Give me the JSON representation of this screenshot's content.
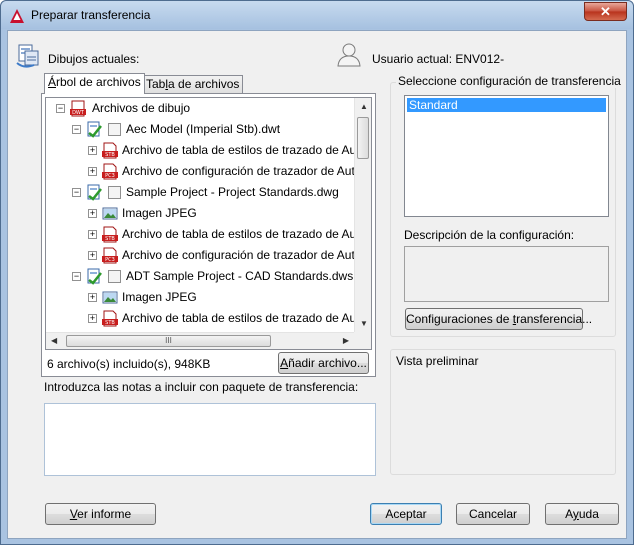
{
  "window": {
    "title": "Preparar transferencia",
    "close_glyph": "✕"
  },
  "header": {
    "current_drawings_label": "Dibujos actuales:",
    "current_user_label": "Usuario actual: ENV012-"
  },
  "tabs": [
    {
      "label_pre": "",
      "label_u": "Á",
      "label_post": "rbol de archivos",
      "active": true
    },
    {
      "label_pre": "Tab",
      "label_u": "l",
      "label_post": "a de archivos",
      "active": false
    }
  ],
  "tree": {
    "root": "Archivos de dibujo",
    "rows": [
      {
        "text": "Aec Model (Imperial Stb).dwt",
        "level": 1,
        "icon": "drawing-icon",
        "check": true
      },
      {
        "text": "Archivo de tabla de estilos de trazado de AutoCA",
        "level": 2,
        "icon": "stb-file-icon"
      },
      {
        "text": "Archivo de configuración de trazador de AutoCA",
        "level": 2,
        "icon": "pc3-file-icon"
      },
      {
        "text": "Sample Project - Project Standards.dwg",
        "level": 1,
        "icon": "drawing-icon",
        "check": true
      },
      {
        "text": "Imagen JPEG",
        "level": 2,
        "icon": "jpeg-image-icon"
      },
      {
        "text": "Archivo de tabla de estilos de trazado de AutoCA",
        "level": 2,
        "icon": "stb-file-icon"
      },
      {
        "text": "Archivo de configuración de trazador de AutoCA",
        "level": 2,
        "icon": "pc3-file-icon"
      },
      {
        "text": "ADT Sample Project - CAD Standards.dws",
        "level": 1,
        "icon": "drawing-icon",
        "check": true
      },
      {
        "text": "Imagen JPEG",
        "level": 2,
        "icon": "jpeg-image-icon"
      },
      {
        "text": "Archivo de tabla de estilos de trazado de AutoCA",
        "level": 2,
        "icon": "stb-file-icon"
      }
    ],
    "scroll_grip": "III"
  },
  "files_summary": "6 archivo(s) incluido(s), 948KB",
  "add_file_button": {
    "pre": "",
    "u": "A",
    "post": "ñadir archivo..."
  },
  "notes_label": "Introduzca las notas a incluir con paquete de transferencia:",
  "transfer_setup": {
    "label": "Seleccione configuración de transferencia",
    "items": [
      "Standard"
    ],
    "selected": "Standard",
    "description_label": "Descripción de la configuración:",
    "setups_button": {
      "pre": "Configuraciones de ",
      "u": "t",
      "post": "ransferencia..."
    }
  },
  "preview_label": "Vista preliminar",
  "footer": {
    "view_report": {
      "pre": "",
      "u": "V",
      "post": "er informe"
    },
    "accept": "Aceptar",
    "cancel": "Cancelar",
    "help": {
      "pre": "A",
      "u": "y",
      "post": "uda"
    }
  },
  "colors": {
    "selection": "#3399ff",
    "title_bg": "#b5cde9",
    "close": "#c7503c"
  }
}
